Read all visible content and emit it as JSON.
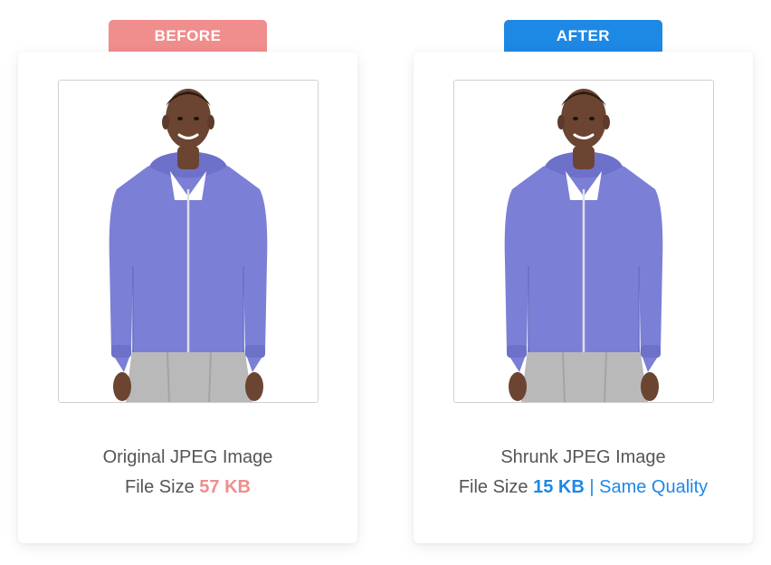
{
  "colors": {
    "before_accent": "#f08d8d",
    "after_accent": "#1e88e5",
    "caption_text": "#555555",
    "hoodie": "#7b7fd6",
    "pants": "#b9b9b9",
    "skin": "#6b4532"
  },
  "before": {
    "tag_label": "BEFORE",
    "title": "Original JPEG Image",
    "size_prefix": "File Size",
    "size_value": "57 KB"
  },
  "after": {
    "tag_label": "AFTER",
    "title": "Shrunk JPEG Image",
    "size_prefix": "File Size",
    "size_value": "15 KB",
    "separator": "|",
    "quality_label": "Same Quality"
  }
}
